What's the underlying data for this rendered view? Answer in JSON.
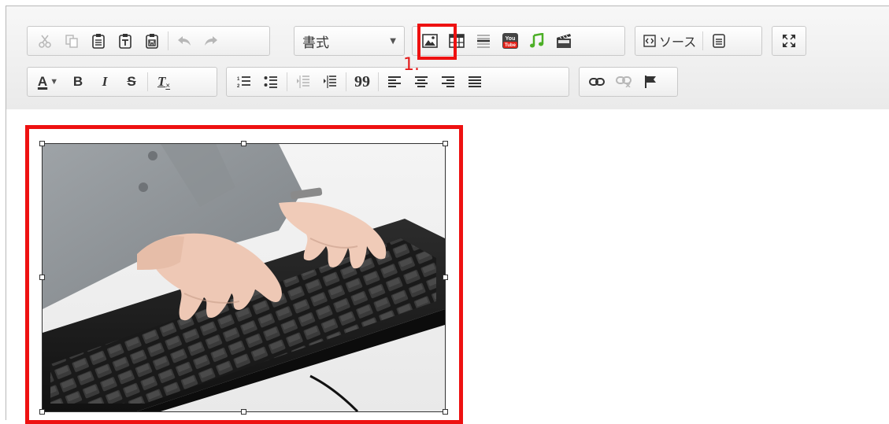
{
  "toolbar": {
    "row1": {
      "clipboard": [
        "cut-icon",
        "copy-icon",
        "paste-icon",
        "paste-text-icon",
        "paste-word-icon"
      ],
      "history": [
        "undo-icon",
        "redo-icon"
      ],
      "format_combo": {
        "value": "書式"
      },
      "insert": [
        "image-icon",
        "table-icon",
        "horizontal-rule-icon",
        "youtube-icon",
        "audio-icon",
        "video-icon"
      ],
      "source_label": "ソース",
      "youtube_text": "You\nTube"
    },
    "row2": {
      "text_color_glyph": "A",
      "bold_glyph": "B",
      "italic_glyph": "I",
      "strike_glyph": "S",
      "clear_format_glyph": "T",
      "quote_glyph": "99"
    }
  },
  "annotation": {
    "step_label": "1.",
    "highlight_color": "#ee1111"
  },
  "content": {
    "image": "keyboard-typing-photo"
  }
}
